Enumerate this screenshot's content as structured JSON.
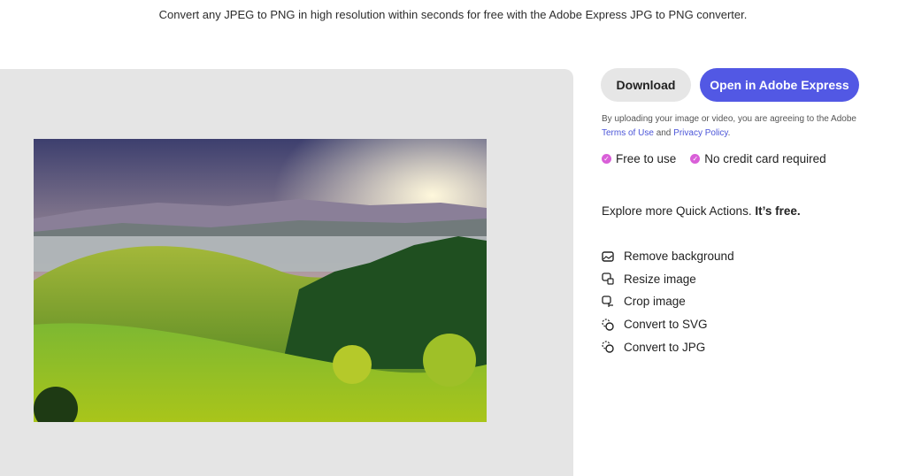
{
  "subtitle": "Convert any JPEG to PNG in high resolution within seconds for free with the Adobe Express JPG to PNG converter.",
  "buttons": {
    "download": "Download",
    "open": "Open in Adobe Express"
  },
  "legal": {
    "text": "By uploading your image or video, you are agreeing to the Adobe",
    "terms": "Terms of Use",
    "and": "and",
    "privacy": "Privacy Policy",
    "period": "."
  },
  "perks": [
    "Free to use",
    "No credit card required"
  ],
  "explore": {
    "text": "Explore more Quick Actions.",
    "bold": "It’s free."
  },
  "actions": [
    {
      "label": "Remove background",
      "icon": "image-icon"
    },
    {
      "label": "Resize image",
      "icon": "resize-image-icon"
    },
    {
      "label": "Crop image",
      "icon": "crop-image-icon"
    },
    {
      "label": "Convert to SVG",
      "icon": "convert-icon"
    },
    {
      "label": "Convert to JPG",
      "icon": "convert-icon"
    }
  ],
  "colors": {
    "accent": "#5258e4",
    "check": "#d95fd8",
    "panel": "#e5e5e5"
  }
}
